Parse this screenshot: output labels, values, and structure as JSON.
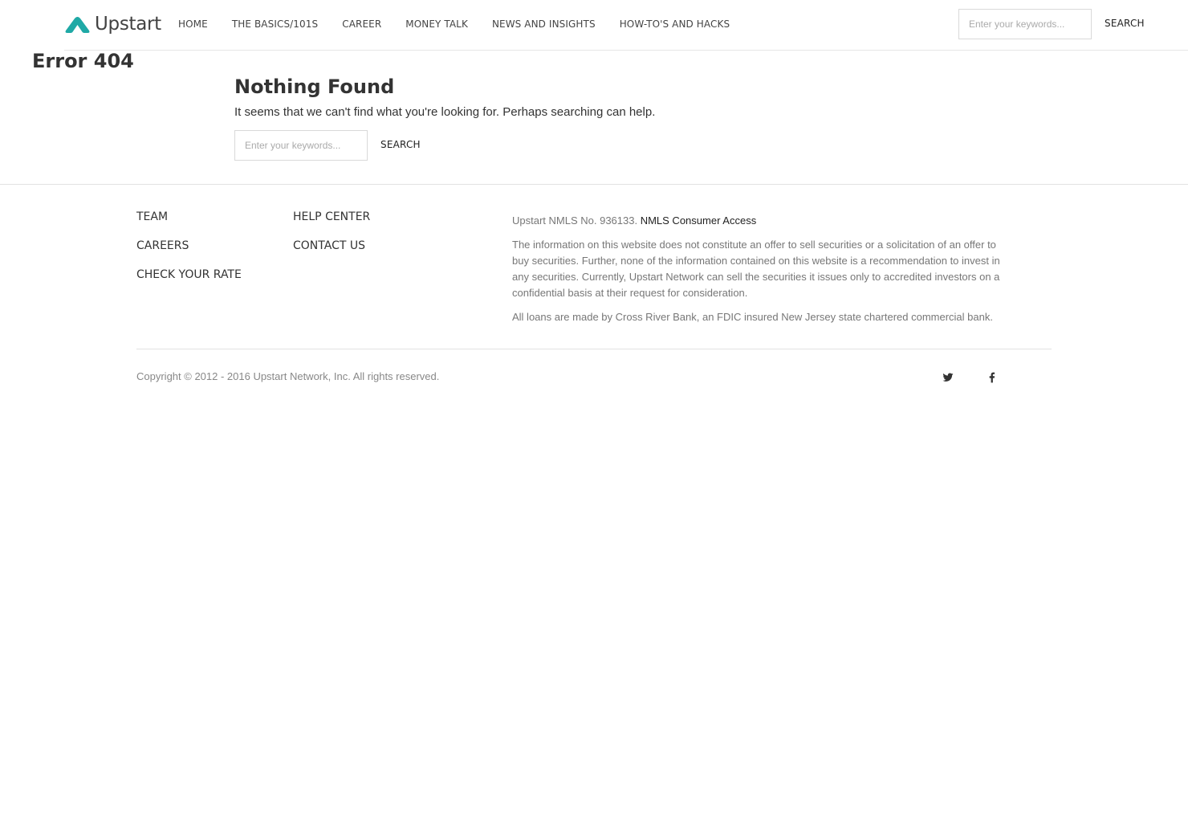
{
  "header": {
    "logo_text": "Upstart",
    "nav": [
      "HOME",
      "THE BASICS/101S",
      "CAREER",
      "MONEY TALK",
      "NEWS AND INSIGHTS",
      "HOW-TO'S AND HACKS"
    ],
    "search": {
      "placeholder": "Enter your keywords...",
      "button": "SEARCH"
    }
  },
  "page": {
    "error_title": "Error 404",
    "title": "Nothing Found",
    "message": "It seems that we can't find what you're looking for. Perhaps searching can help.",
    "search": {
      "placeholder": "Enter your keywords...",
      "button": "SEARCH"
    }
  },
  "footer": {
    "col1": [
      "TEAM",
      "CAREERS",
      "CHECK YOUR RATE"
    ],
    "col2": [
      "HELP CENTER",
      "CONTACT US"
    ],
    "nmls_text": "Upstart NMLS No. 936133.",
    "nmls_link": "NMLS Consumer Access",
    "disclaimer": "The information on this website does not constitute an offer to sell securities or a solicitation of an offer to buy securities. Further, none of the information contained on this website is a recommendation to invest in any securities. Currently, Upstart Network can sell the securities it issues only to accredited investors on a confidential basis at their request for consideration.",
    "loans": "All loans are made by Cross River Bank, an FDIC insured New Jersey state chartered commercial bank.",
    "copyright": "Copyright © 2012 - 2016 Upstart Network, Inc. All rights reserved.",
    "social": [
      "twitter-icon",
      "facebook-icon"
    ]
  },
  "colors": {
    "brand": "#1fa9a6"
  }
}
